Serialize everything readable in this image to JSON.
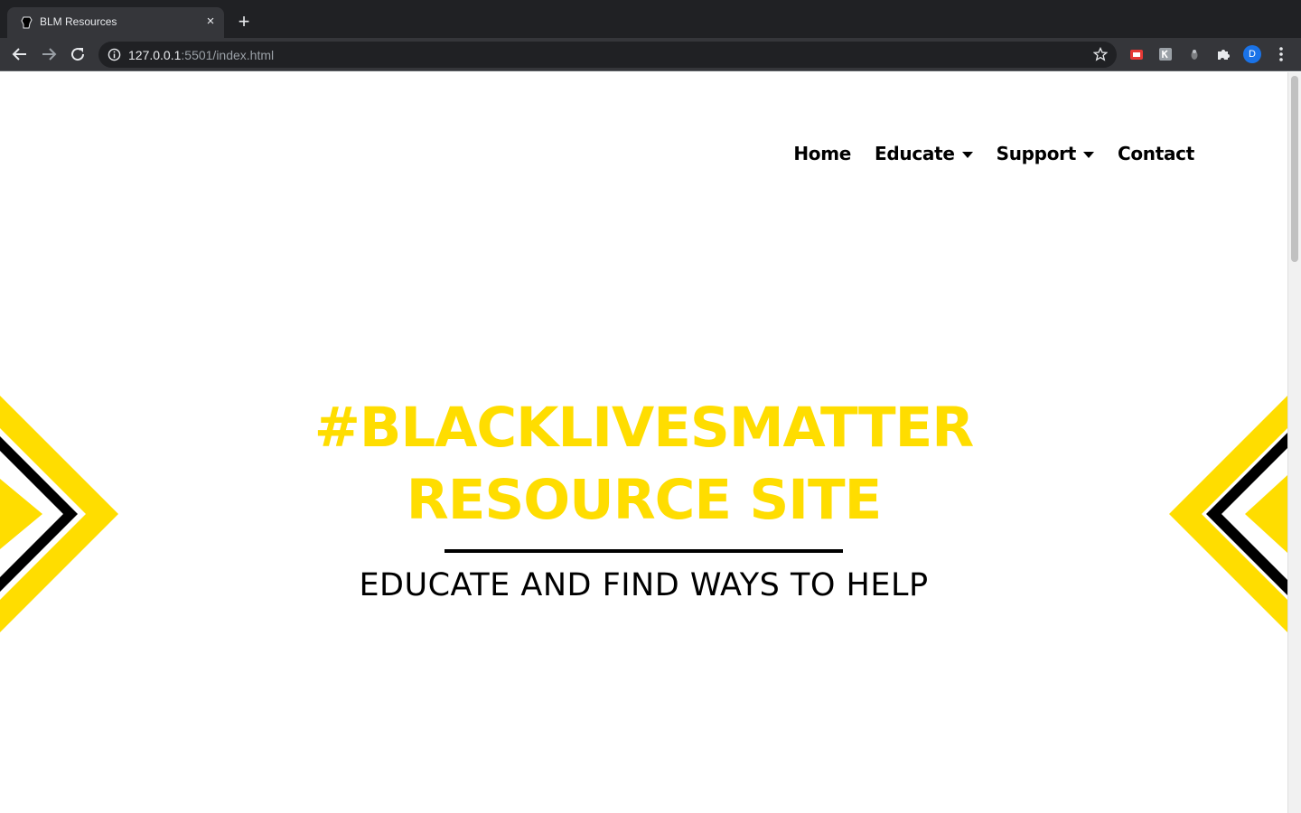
{
  "browser": {
    "tab_title": "BLM Resources",
    "close_glyph": "×",
    "new_tab_glyph": "+",
    "url_host": "127.0.0.1",
    "url_rest": ":5501/index.html",
    "profile_initial": "D"
  },
  "nav": {
    "home": "Home",
    "educate": "Educate",
    "support": "Support",
    "contact": "Contact"
  },
  "hero": {
    "title_line1": "#BLACKLIVESMATTER",
    "title_line2": "RESOURCE SITE",
    "subtitle": "EDUCATE AND FIND WAYS TO HELP"
  },
  "colors": {
    "accent": "#ffdd00",
    "text": "#000000",
    "background": "#ffffff"
  }
}
